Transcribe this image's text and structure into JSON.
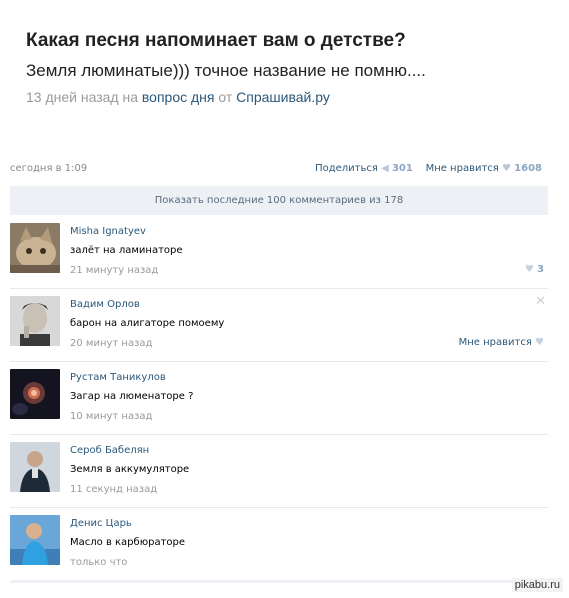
{
  "post": {
    "title": "Какая песня напоминает вам о детстве?",
    "answer": "Земля люминатые))) точное название не помню....",
    "meta_time": "13 дней назад на ",
    "meta_source": "вопрос дня",
    "meta_from": " от ",
    "meta_site": "Спрашивай.ру"
  },
  "bar": {
    "date": "сегодня в 1:09",
    "share_label": "Поделиться",
    "share_count": "301",
    "like_label": "Мне нравится",
    "like_count": "1608"
  },
  "show_all": "Показать последние 100 комментариев из 178",
  "comments": [
    {
      "name": "Misha Ignatyev",
      "text": "залёт на ламинаторе",
      "time": "21 минуту назад",
      "likes": "3",
      "like_label": ""
    },
    {
      "name": "Вадим Орлов",
      "text": "барон на алигаторе помоему",
      "time": "20 минут назад",
      "likes": "",
      "like_label": "Мне нравится"
    },
    {
      "name": "Рустам Таникулов",
      "text": "Загар на люменаторе ?",
      "time": "10 минут назад",
      "likes": "",
      "like_label": ""
    },
    {
      "name": "Сероб Бабелян",
      "text": "Земля в аккумуляторе",
      "time": "11 секунд назад",
      "likes": "",
      "like_label": ""
    },
    {
      "name": "Денис Царь",
      "text": "Масло в карбюраторе",
      "time": "только что",
      "likes": "",
      "like_label": ""
    }
  ],
  "icons": {
    "share": "megaphone-icon",
    "like": "heart-icon",
    "delete": "close-icon"
  },
  "colors": {
    "link": "#2b587a",
    "muted": "#999999",
    "bar_bg": "#edf0f5"
  },
  "watermark": "pikabu.ru"
}
